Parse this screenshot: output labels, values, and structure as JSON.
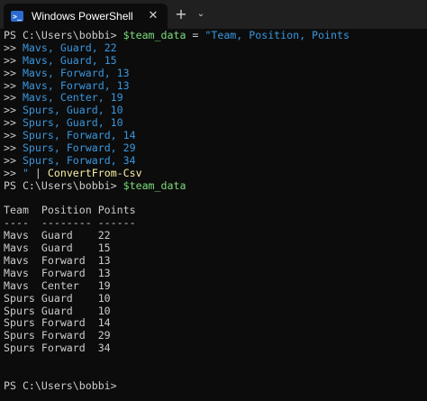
{
  "window": {
    "tab_title": "Windows PowerShell",
    "tab_icon": "powershell-icon",
    "close_glyph": "✕",
    "new_tab_glyph": "+",
    "dropdown_glyph": "⌄"
  },
  "colors": {
    "background": "#0c0c0c",
    "titlebar": "#202020",
    "variable": "#7bdc7a",
    "string": "#3a96dd",
    "command": "#f9f1a5",
    "text": "#cccccc"
  },
  "console_lines": [
    [
      {
        "t": "PS C:\\Users\\bobbi> ",
        "c": "def"
      },
      {
        "t": "$team_data",
        "c": "var"
      },
      {
        "t": " = ",
        "c": "def"
      },
      {
        "t": "\"Team, Position, Points",
        "c": "str"
      }
    ],
    [
      {
        "t": ">> ",
        "c": "def"
      },
      {
        "t": "Mavs, Guard, 22",
        "c": "str"
      }
    ],
    [
      {
        "t": ">> ",
        "c": "def"
      },
      {
        "t": "Mavs, Guard, 15",
        "c": "str"
      }
    ],
    [
      {
        "t": ">> ",
        "c": "def"
      },
      {
        "t": "Mavs, Forward, 13",
        "c": "str"
      }
    ],
    [
      {
        "t": ">> ",
        "c": "def"
      },
      {
        "t": "Mavs, Forward, 13",
        "c": "str"
      }
    ],
    [
      {
        "t": ">> ",
        "c": "def"
      },
      {
        "t": "Mavs, Center, 19",
        "c": "str"
      }
    ],
    [
      {
        "t": ">> ",
        "c": "def"
      },
      {
        "t": "Spurs, Guard, 10",
        "c": "str"
      }
    ],
    [
      {
        "t": ">> ",
        "c": "def"
      },
      {
        "t": "Spurs, Guard, 10",
        "c": "str"
      }
    ],
    [
      {
        "t": ">> ",
        "c": "def"
      },
      {
        "t": "Spurs, Forward, 14",
        "c": "str"
      }
    ],
    [
      {
        "t": ">> ",
        "c": "def"
      },
      {
        "t": "Spurs, Forward, 29",
        "c": "str"
      }
    ],
    [
      {
        "t": ">> ",
        "c": "def"
      },
      {
        "t": "Spurs, Forward, 34",
        "c": "str"
      }
    ],
    [
      {
        "t": ">> ",
        "c": "def"
      },
      {
        "t": "\"",
        "c": "str"
      },
      {
        "t": " | ",
        "c": "def"
      },
      {
        "t": "ConvertFrom-Csv",
        "c": "cmd"
      }
    ],
    [
      {
        "t": "PS C:\\Users\\bobbi> ",
        "c": "def"
      },
      {
        "t": "$team_data",
        "c": "var"
      }
    ],
    [],
    [
      {
        "t": "Team  Position Points",
        "c": "def"
      }
    ],
    [
      {
        "t": "----  -------- ------",
        "c": "def"
      }
    ],
    [
      {
        "t": "Mavs  Guard    22",
        "c": "def"
      }
    ],
    [
      {
        "t": "Mavs  Guard    15",
        "c": "def"
      }
    ],
    [
      {
        "t": "Mavs  Forward  13",
        "c": "def"
      }
    ],
    [
      {
        "t": "Mavs  Forward  13",
        "c": "def"
      }
    ],
    [
      {
        "t": "Mavs  Center   19",
        "c": "def"
      }
    ],
    [
      {
        "t": "Spurs Guard    10",
        "c": "def"
      }
    ],
    [
      {
        "t": "Spurs Guard    10",
        "c": "def"
      }
    ],
    [
      {
        "t": "Spurs Forward  14",
        "c": "def"
      }
    ],
    [
      {
        "t": "Spurs Forward  29",
        "c": "def"
      }
    ],
    [
      {
        "t": "Spurs Forward  34",
        "c": "def"
      }
    ],
    [],
    [],
    [
      {
        "t": "PS C:\\Users\\bobbi>",
        "c": "def"
      }
    ]
  ]
}
